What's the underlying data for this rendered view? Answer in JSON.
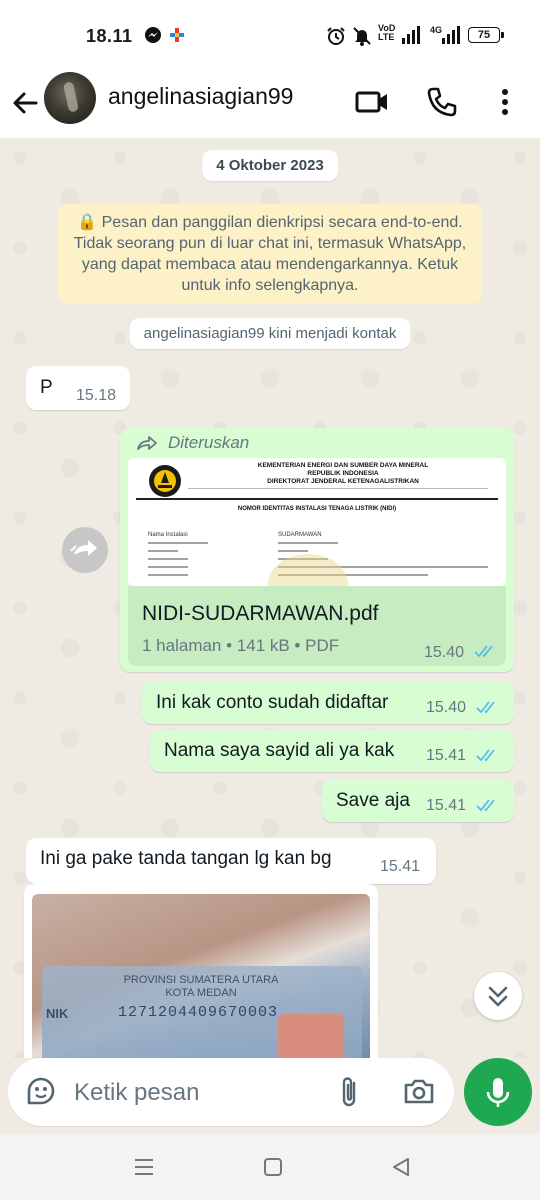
{
  "status_bar": {
    "time": "18.11",
    "net_label_1": "VoD",
    "net_label_2": "LTE",
    "net_label_3": "4G",
    "battery": "75"
  },
  "header": {
    "contact_name": "angelinasiagian99"
  },
  "chat": {
    "date": "4 Oktober 2023",
    "encryption_notice": "🔒 Pesan dan panggilan dienkripsi secara end-to-end. Tidak seorang pun di luar chat ini, termasuk WhatsApp, yang dapat membaca atau mendengarkannya. Ketuk untuk info selengkapnya.",
    "system_message": "angelinasiagian99 kini menjadi kontak",
    "messages": [
      {
        "text": "P",
        "time": "15.18"
      },
      {
        "forwarded_label": "Diteruskan",
        "doc_preview": {
          "line1": "KEMENTERIAN ENERGI DAN SUMBER DAYA MINERAL",
          "line2": "REPUBLIK INDONESIA",
          "line3": "DIREKTORAT JENDERAL KETENAGALISTRIKAN",
          "heading": "NOMOR IDENTITAS INSTALASI TENAGA LISTRIK (NIDI)",
          "name_label": "Nama Instalasi",
          "name_value": "SUDARMAWAN"
        },
        "file_name": "NIDI-SUDARMAWAN.pdf",
        "file_meta": "1 halaman • 141 kB • PDF",
        "time": "15.40"
      },
      {
        "text": "Ini kak conto sudah didaftar",
        "time": "15.40"
      },
      {
        "text": "Nama saya sayid ali ya kak",
        "time": "15.41"
      },
      {
        "text": "Save aja",
        "time": "15.41"
      },
      {
        "text": "Ini ga pake tanda tangan lg kan bg",
        "time": "15.41"
      },
      {
        "photo_text_1": "PROVINSI SUMATERA UTARA",
        "photo_text_2": "KOTA MEDAN",
        "photo_text_3": "NIK",
        "photo_text_4": "1271204409670003"
      }
    ]
  },
  "composer": {
    "placeholder": "Ketik pesan"
  },
  "colors": {
    "accent": "#1da851",
    "out_bubble": "#d9fdd3",
    "in_bubble": "#ffffff",
    "read_ticks": "#53bdeb"
  }
}
